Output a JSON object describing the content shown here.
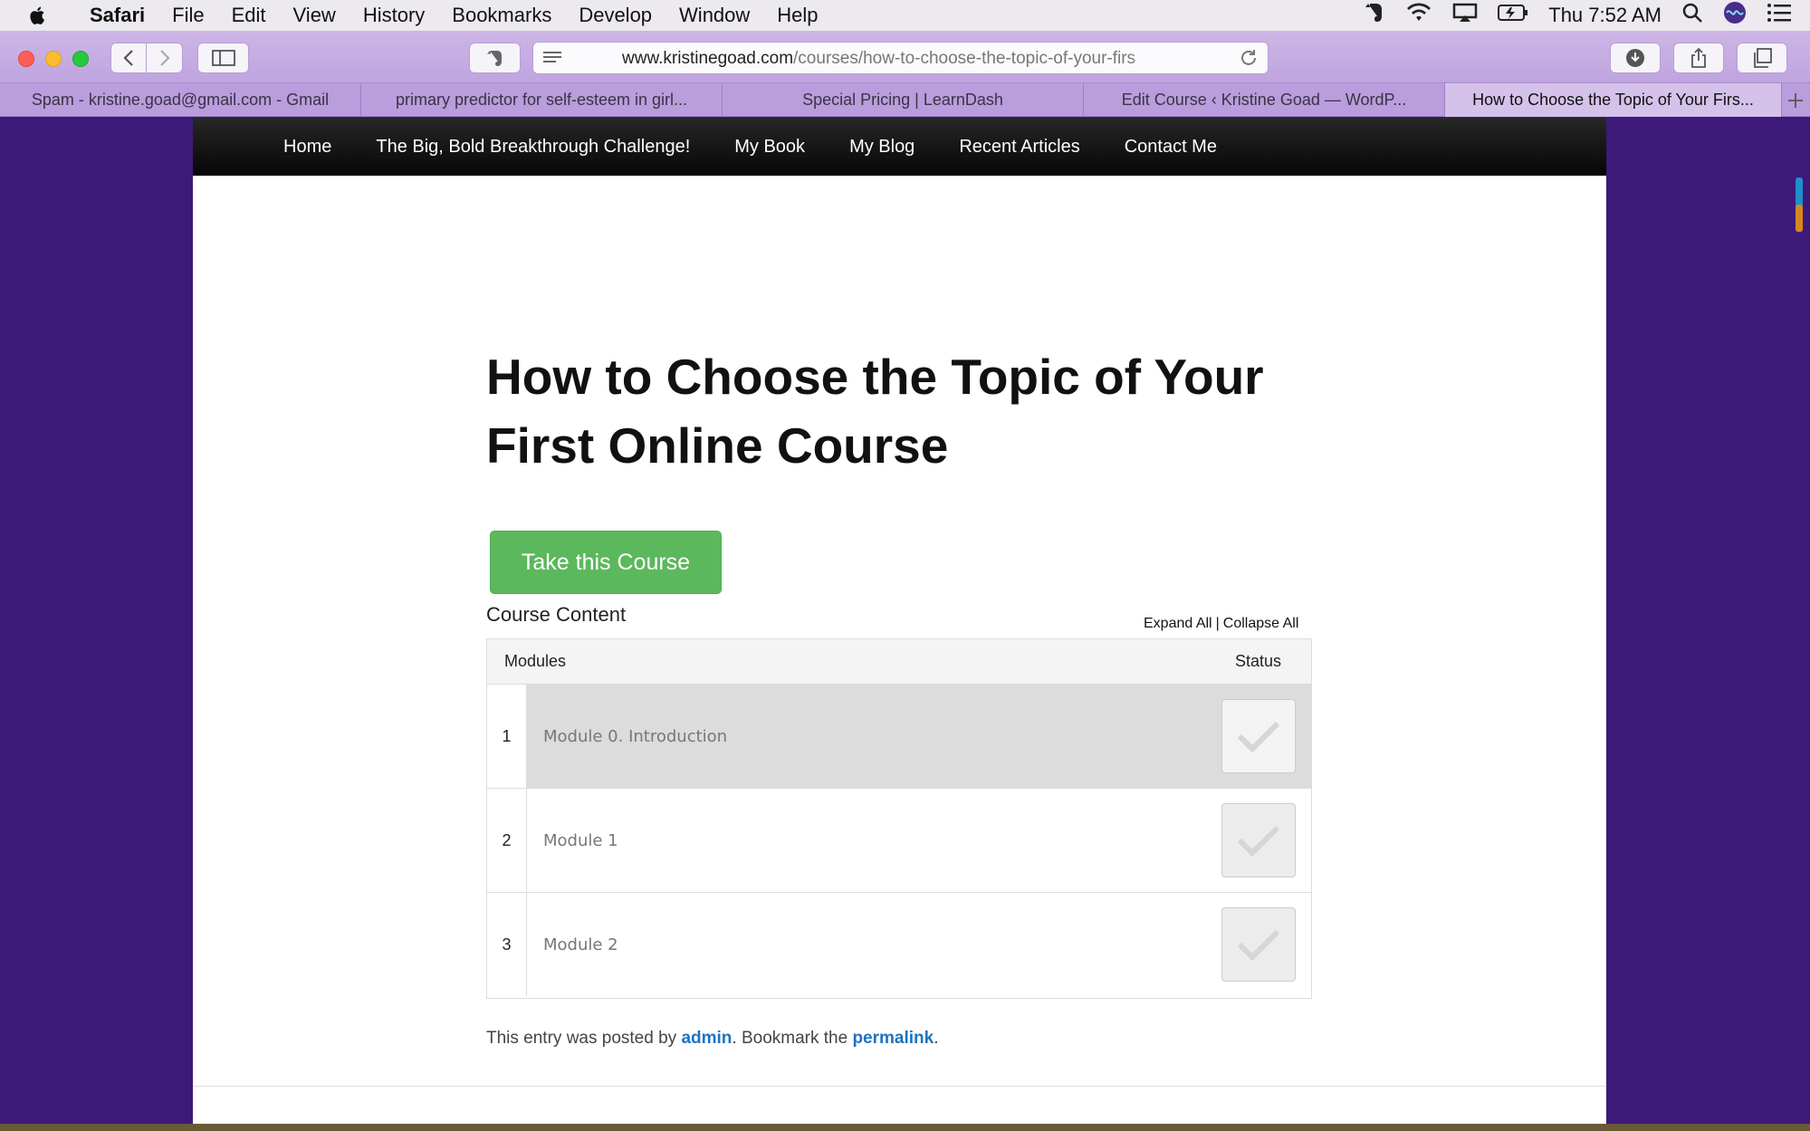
{
  "menubar": {
    "app_name": "Safari",
    "menus": [
      "File",
      "Edit",
      "View",
      "History",
      "Bookmarks",
      "Develop",
      "Window",
      "Help"
    ],
    "clock": "Thu 7:52 AM"
  },
  "browser": {
    "url_domain": "www.kristinegoad.com",
    "url_path": "/courses/how-to-choose-the-topic-of-your-firs",
    "tabs": [
      {
        "label": "Spam - kristine.goad@gmail.com - Gmail"
      },
      {
        "label": "primary predictor for self-esteem in girl..."
      },
      {
        "label": "Special Pricing | LearnDash"
      },
      {
        "label": "Edit Course ‹ Kristine Goad — WordP..."
      },
      {
        "label": "How to Choose the Topic of Your Firs..."
      }
    ]
  },
  "site_nav": {
    "items": [
      "Home",
      "The Big, Bold Breakthrough Challenge!",
      "My Book",
      "My Blog",
      "Recent Articles",
      "Contact Me"
    ]
  },
  "course": {
    "title_line1": "How to Choose the Topic of Your",
    "title_line2": "First Online Course",
    "take_button": "Take this Course",
    "content_heading": "Course Content",
    "expand_all": "Expand All",
    "separator": "|",
    "collapse_all": "Collapse All",
    "table": {
      "col_modules": "Modules",
      "col_status": "Status",
      "rows": [
        {
          "num": "1",
          "name": "Module 0. Introduction"
        },
        {
          "num": "2",
          "name": "Module 1"
        },
        {
          "num": "3",
          "name": "Module 2"
        }
      ]
    }
  },
  "entry_meta": {
    "prefix": "This entry was posted by",
    "author": "admin",
    "middle": ". Bookmark the",
    "permalink": "permalink",
    "suffix": "."
  }
}
